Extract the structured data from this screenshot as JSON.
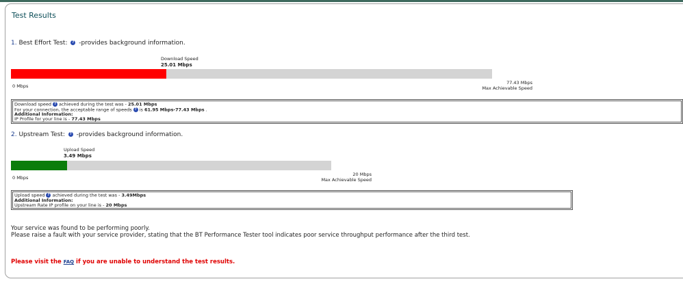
{
  "title": "Test Results",
  "best_effort": {
    "index": "1.",
    "name": "Best Effort Test:",
    "help_text": "-provides background information.",
    "bar_title": "Download Speed",
    "bar_value": "25.01 Mbps",
    "fill_fraction": 0.323,
    "fill_color": "#ff0000",
    "scale_min": "0 Mbps",
    "scale_max": "77.43 Mbps",
    "scale_max_caption": "Max Achievable Speed",
    "info": {
      "line1_prefix": "Download speed",
      "line1_mid": "achieved during the test was - ",
      "line1_value": "25.01 Mbps",
      "line2_prefix": "For your connection, the acceptable range of speeds",
      "line2_mid": "is ",
      "line2_value": "61.95 Mbps-77.43 Mbps",
      "line2_suffix": " .",
      "additional_label": "Additional Information:",
      "line3_prefix": "IP Profile for your line is - ",
      "line3_value": "77.43 Mbps"
    }
  },
  "upstream": {
    "index": "2.",
    "name": "Upstream Test:",
    "help_text": "-provides background information.",
    "bar_title": "Upload Speed",
    "bar_value": "3.49 Mbps",
    "fill_fraction": 0.1745,
    "fill_color": "#0b7d0b",
    "scale_min": "0 Mbps",
    "scale_max": "20 Mbps",
    "scale_max_caption": "Max Achievable Speed",
    "info": {
      "line1_prefix": "Upload speed",
      "line1_mid": "achieved during the test was - ",
      "line1_value": "3.49Mbps",
      "additional_label": "Additional Information:",
      "line2_prefix": "Upstream Rate IP profile on your line is - ",
      "line2_value": "20 Mbps"
    }
  },
  "message": {
    "line1": "Your service was found to be performing poorly.",
    "line2": "Please raise a fault with your service provider, stating that the BT Performance Tester tool indicates poor service throughput performance after the third test."
  },
  "faq": {
    "before": "Please visit the ",
    "link": "FAQ",
    "after": " if you are unable to understand the test results."
  },
  "colors": {
    "accent": "#3e6a5e",
    "title": "#0b4d57",
    "warning": "#e00000"
  }
}
